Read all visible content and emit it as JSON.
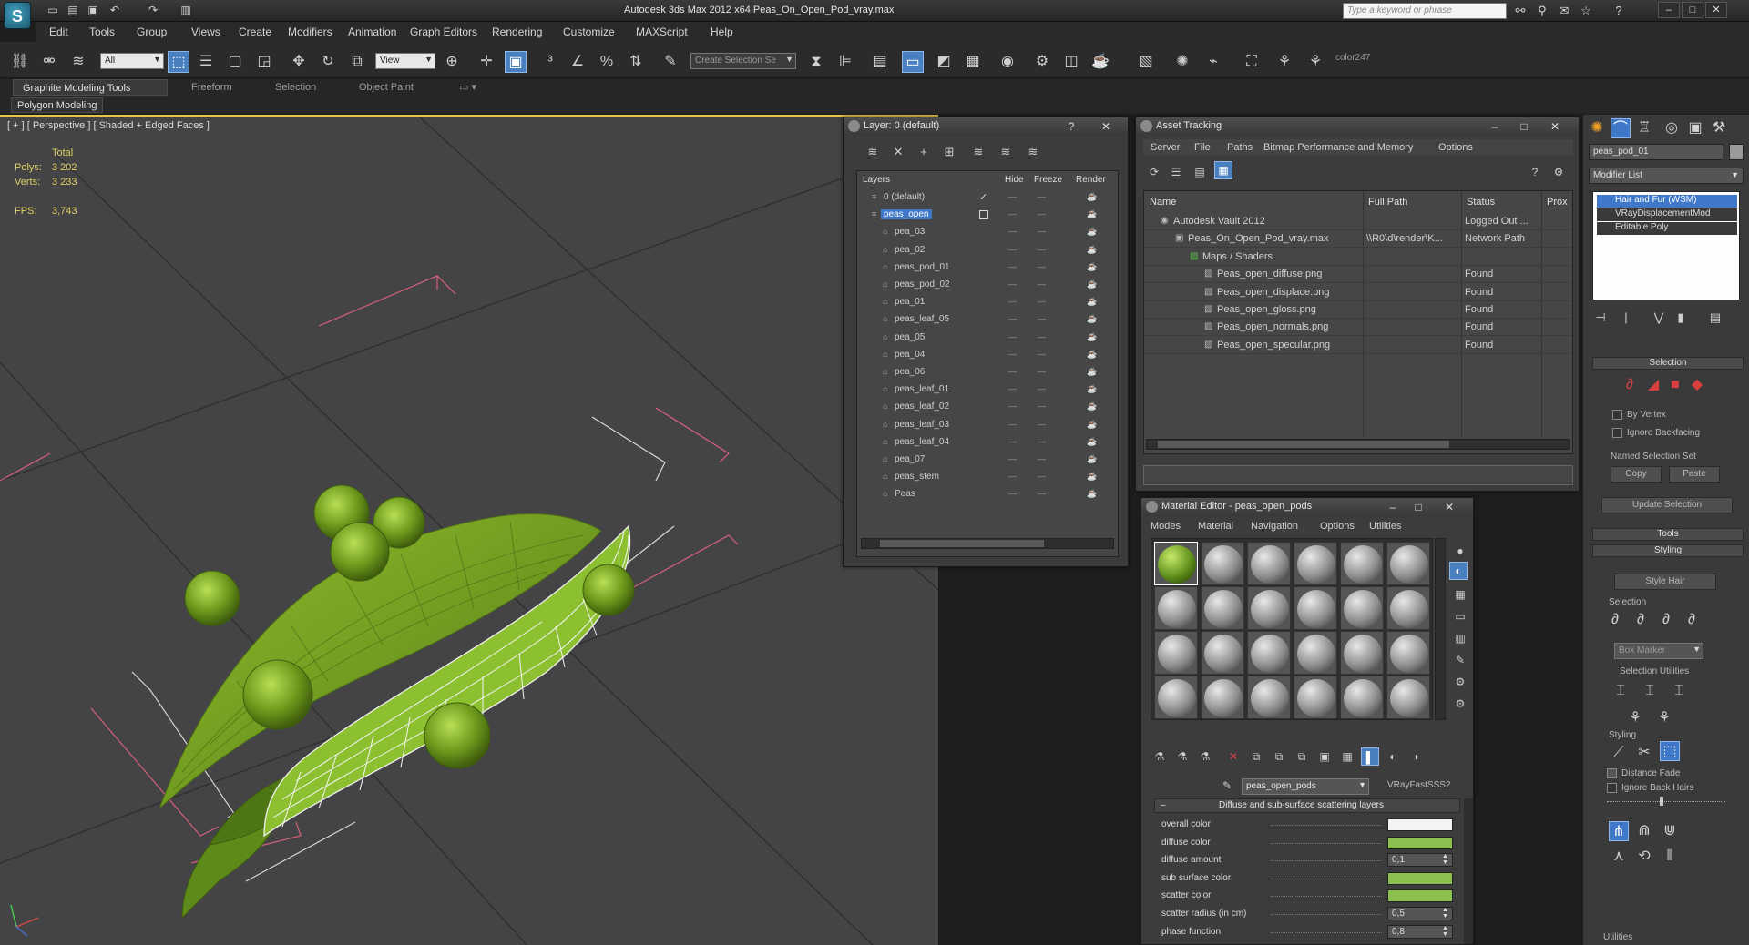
{
  "title_bar": {
    "app_logo": "S",
    "title": "Autodesk 3ds Max 2012 x64     Peas_On_Open_Pod_vray.max",
    "search_placeholder": "Type a keyword or phrase"
  },
  "menu": {
    "items": [
      "Edit",
      "Tools",
      "Group",
      "Views",
      "Create",
      "Modifiers",
      "Animation",
      "Graph Editors",
      "Rendering",
      "Customize",
      "MAXScript",
      "Help"
    ]
  },
  "toolbar": {
    "selection_filter": "All",
    "reference_coord": "View",
    "named_selection_placeholder": "Create Selection Se",
    "color_label": "color247"
  },
  "ribbon": {
    "tabs": [
      "Graphite Modeling Tools",
      "Freeform",
      "Selection",
      "Object Paint"
    ],
    "panel_label": "Polygon Modeling"
  },
  "viewport": {
    "label": "[ + ] [ Perspective ] [ Shaded + Edged Faces ]",
    "stats": {
      "total_label": "Total",
      "polys_label": "Polys:",
      "polys_value": "3 202",
      "verts_label": "Verts:",
      "verts_value": "3 233",
      "fps_label": "FPS:",
      "fps_value": "3,743"
    }
  },
  "layer_window": {
    "title": "Layer: 0 (default)",
    "columns": [
      "Layers",
      "Hide",
      "Freeze",
      "Render"
    ],
    "rows": [
      {
        "name": "0 (default)",
        "level": 1,
        "selected": false
      },
      {
        "name": "peas_open",
        "level": 1,
        "selected": true
      },
      {
        "name": "pea_03",
        "level": 2,
        "selected": false
      },
      {
        "name": "pea_02",
        "level": 2,
        "selected": false
      },
      {
        "name": "peas_pod_01",
        "level": 2,
        "selected": false
      },
      {
        "name": "peas_pod_02",
        "level": 2,
        "selected": false
      },
      {
        "name": "pea_01",
        "level": 2,
        "selected": false
      },
      {
        "name": "peas_leaf_05",
        "level": 2,
        "selected": false
      },
      {
        "name": "pea_05",
        "level": 2,
        "selected": false
      },
      {
        "name": "pea_04",
        "level": 2,
        "selected": false
      },
      {
        "name": "pea_06",
        "level": 2,
        "selected": false
      },
      {
        "name": "peas_leaf_01",
        "level": 2,
        "selected": false
      },
      {
        "name": "peas_leaf_02",
        "level": 2,
        "selected": false
      },
      {
        "name": "peas_leaf_03",
        "level": 2,
        "selected": false
      },
      {
        "name": "peas_leaf_04",
        "level": 2,
        "selected": false
      },
      {
        "name": "pea_07",
        "level": 2,
        "selected": false
      },
      {
        "name": "peas_stem",
        "level": 2,
        "selected": false
      },
      {
        "name": "Peas",
        "level": 2,
        "selected": false
      }
    ]
  },
  "asset_window": {
    "title": "Asset Tracking",
    "menu": [
      "Server",
      "File",
      "Paths",
      "Bitmap Performance and Memory",
      "Options"
    ],
    "columns": [
      "Name",
      "Full Path",
      "Status",
      "Prox"
    ],
    "rows": [
      {
        "name": "Autodesk Vault 2012",
        "path": "",
        "status": "Logged Out ...",
        "level": 1
      },
      {
        "name": "Peas_On_Open_Pod_vray.max",
        "path": "\\\\R0\\d\\render\\K...",
        "status": "Network Path",
        "level": 2
      },
      {
        "name": "Maps / Shaders",
        "path": "",
        "status": "",
        "level": 3
      },
      {
        "name": "Peas_open_diffuse.png",
        "path": "",
        "status": "Found",
        "level": 4
      },
      {
        "name": "Peas_open_displace.png",
        "path": "",
        "status": "Found",
        "level": 4
      },
      {
        "name": "Peas_open_gloss.png",
        "path": "",
        "status": "Found",
        "level": 4
      },
      {
        "name": "Peas_open_normals.png",
        "path": "",
        "status": "Found",
        "level": 4
      },
      {
        "name": "Peas_open_specular.png",
        "path": "",
        "status": "Found",
        "level": 4
      }
    ]
  },
  "material_editor": {
    "title": "Material Editor - peas_open_pods",
    "menu": [
      "Modes",
      "Material",
      "Navigation",
      "Options",
      "Utilities"
    ],
    "material_name": "peas_open_pods",
    "material_type": "VRayFastSSS2",
    "rollout_title": "Diffuse and sub-surface scattering layers",
    "props": [
      {
        "label": "overall color",
        "kind": "swatch",
        "value": "#f4f4f4"
      },
      {
        "label": "diffuse color",
        "kind": "swatch",
        "value": "#8cc152"
      },
      {
        "label": "diffuse amount",
        "kind": "spinner",
        "value": "0,1"
      },
      {
        "label": "sub surface color",
        "kind": "swatch",
        "value": "#8cc152"
      },
      {
        "label": "scatter color",
        "kind": "swatch",
        "value": "#8cc152"
      },
      {
        "label": "scatter radius (in cm)",
        "kind": "spinner",
        "value": "0,5"
      },
      {
        "label": "phase function",
        "kind": "spinner",
        "value": "0,8"
      }
    ]
  },
  "command_panel": {
    "object_name": "peas_pod_01",
    "modifier_list_label": "Modifier List",
    "stack": [
      "Hair and Fur (WSM)",
      "VRayDisplacementMod",
      "Editable Poly"
    ],
    "selection_title": "Selection",
    "by_vertex": "By Vertex",
    "ignore_backfacing": "Ignore Backfacing",
    "named_selection_set": "Named Selection Set",
    "copy": "Copy",
    "paste": "Paste",
    "update_selection": "Update Selection",
    "tools_title": "Tools",
    "styling_title": "Styling",
    "style_hair": "Style Hair",
    "selection_sub": "Selection",
    "box_marker": "Box Marker",
    "selection_utilities": "Selection Utilities",
    "styling_sub": "Styling",
    "distance_fade": "Distance Fade",
    "ignore_back_hairs": "Ignore Back Hairs",
    "utilities": "Utilities"
  },
  "colors": {
    "accent_blue": "#3f78c8",
    "pea_green": "#8cc152",
    "stat_yellow": "#e0d060",
    "viewport_bg": "#444446"
  }
}
